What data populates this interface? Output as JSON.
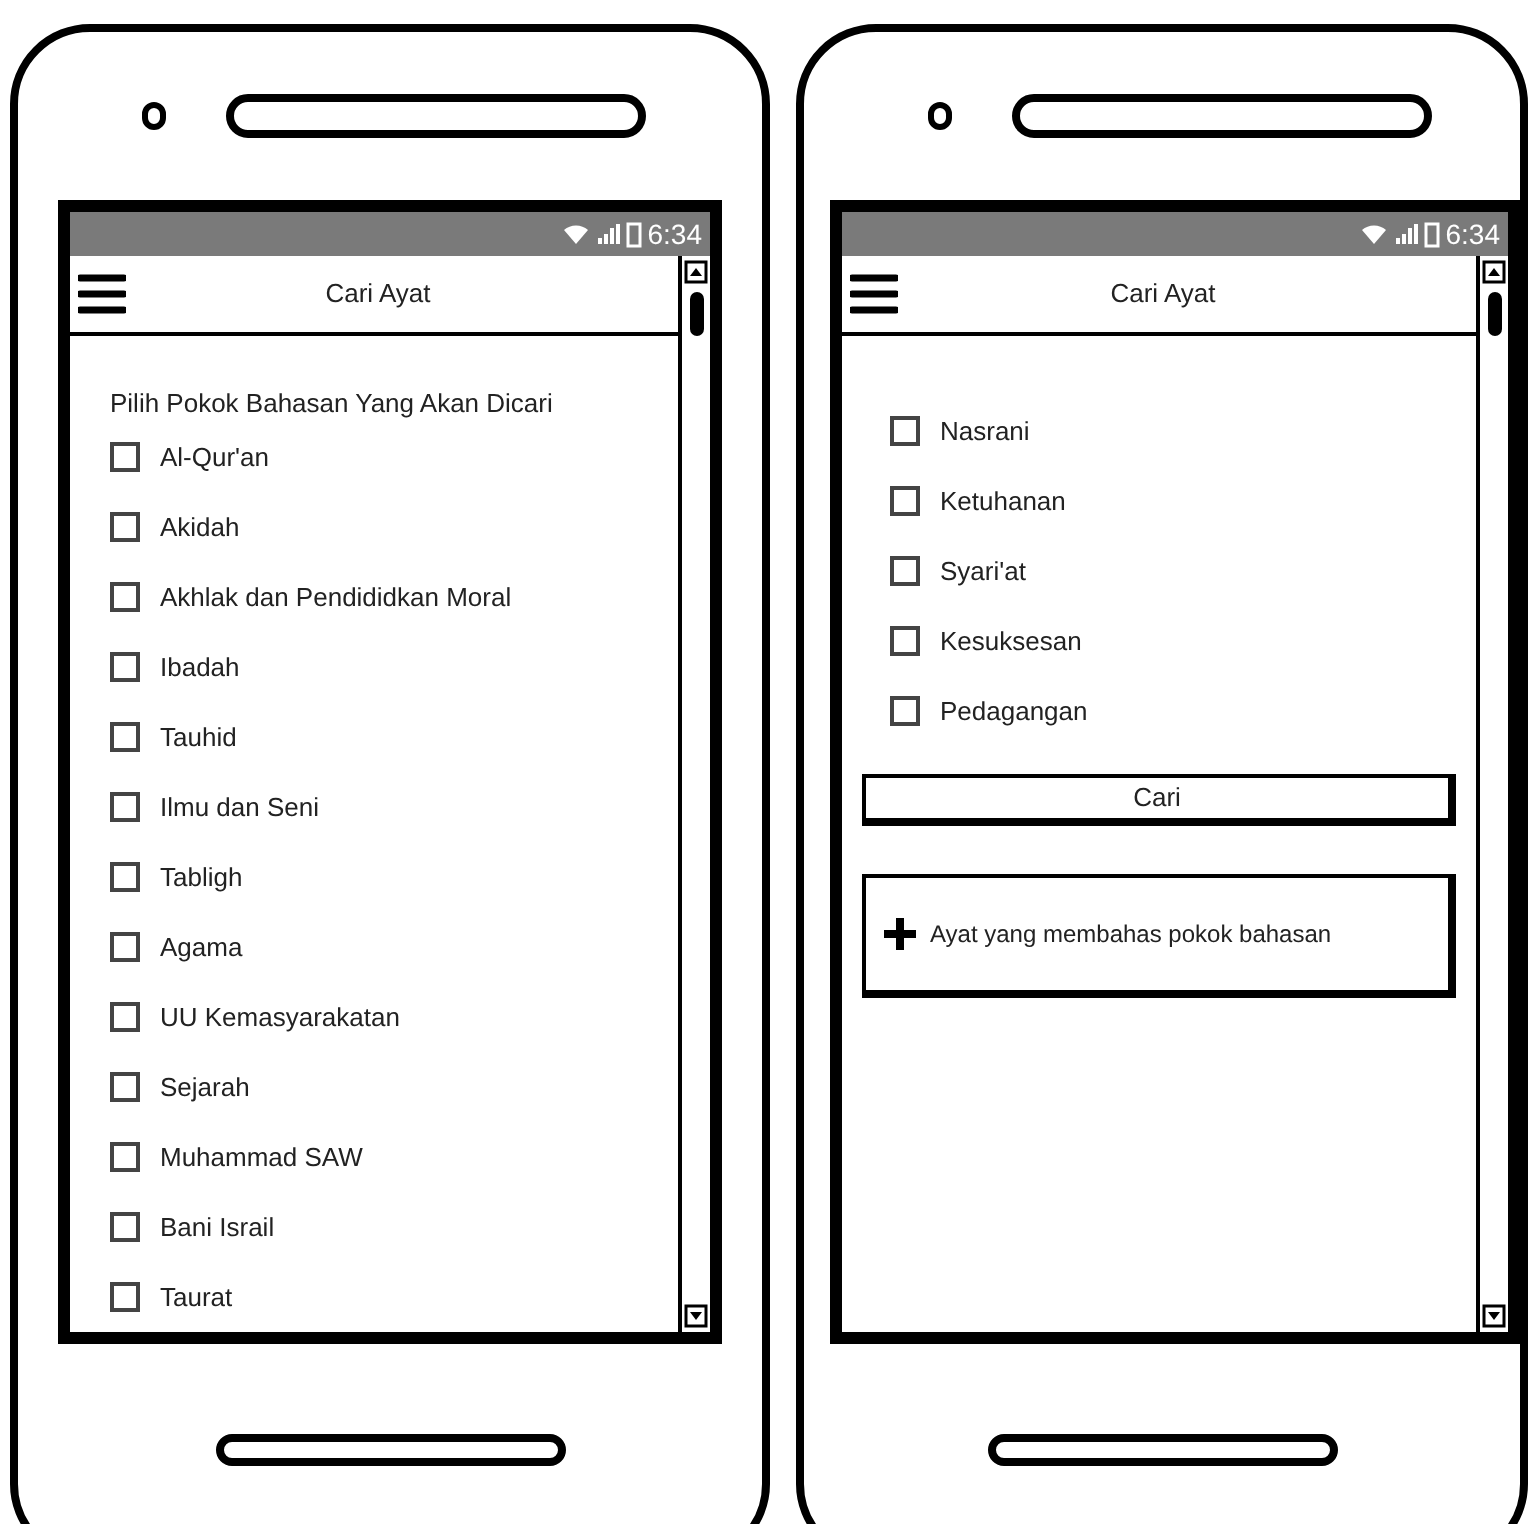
{
  "phones": [
    {
      "status_bar": {
        "time": "6:34"
      },
      "title": "Cari Ayat",
      "heading": "Pilih Pokok Bahasan Yang Akan Dicari",
      "options": [
        {
          "label": "Al-Qur'an",
          "checked": false
        },
        {
          "label": "Akidah",
          "checked": false
        },
        {
          "label": "Akhlak dan Pendididkan Moral",
          "checked": false
        },
        {
          "label": "Ibadah",
          "checked": false
        },
        {
          "label": "Tauhid",
          "checked": false
        },
        {
          "label": "Ilmu dan Seni",
          "checked": false
        },
        {
          "label": "Tabligh",
          "checked": false
        },
        {
          "label": "Agama",
          "checked": false
        },
        {
          "label": "UU Kemasyarakatan",
          "checked": false
        },
        {
          "label": "Sejarah",
          "checked": false
        },
        {
          "label": "Muhammad SAW",
          "checked": false
        },
        {
          "label": "Bani Israil",
          "checked": false
        },
        {
          "label": "Taurat",
          "checked": false
        }
      ]
    },
    {
      "status_bar": {
        "time": "6:34"
      },
      "title": "Cari Ayat",
      "options": [
        {
          "label": "Nasrani",
          "checked": false
        },
        {
          "label": "Ketuhanan",
          "checked": false
        },
        {
          "label": "Syari'at",
          "checked": false
        },
        {
          "label": "Kesuksesan",
          "checked": false
        },
        {
          "label": "Pedagangan",
          "checked": false
        }
      ],
      "search_button": "Cari",
      "result_panel": {
        "label": "Ayat yang membahas pokok bahasan"
      }
    }
  ]
}
